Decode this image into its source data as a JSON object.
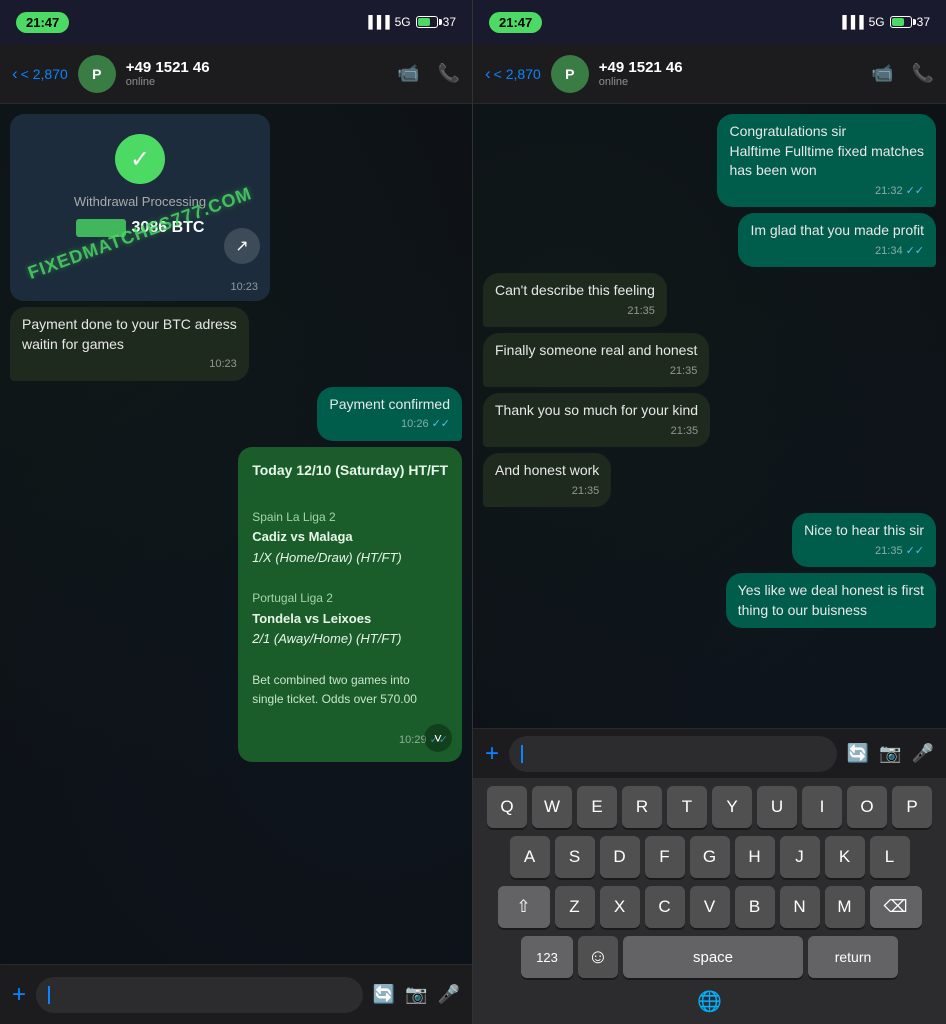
{
  "left_panel": {
    "status_bar": {
      "time": "21:47",
      "signal": "5G",
      "battery": "37"
    },
    "header": {
      "back_label": "< 2,870",
      "contact_name": "+49 1521 46",
      "contact_status": "online",
      "avatar_initials": "P"
    },
    "messages": [
      {
        "type": "incoming",
        "kind": "withdrawal_card",
        "check": "✓",
        "label": "Withdrawal Processing",
        "amount": "3086 BTC",
        "watermark": "FIXEDMATCHES777.COM",
        "time": "10:23"
      },
      {
        "type": "incoming",
        "text": "Payment done to your BTC adress\nwaitin for games",
        "time": "10:23"
      },
      {
        "type": "outgoing",
        "text": "Payment confirmed",
        "time": "10:26",
        "ticks": "✓✓"
      },
      {
        "type": "outgoing",
        "kind": "games_card",
        "title": "Today 12/10 (Saturday) HT/FT",
        "league1": "Spain La Liga 2",
        "match1": "Cadiz vs Malaga",
        "tip1": "1/X (Home/Draw) (HT/FT)",
        "league2": "Portugal Liga 2",
        "match2": "Tondela vs Leixoes",
        "tip2": "2/1 (Away/Home) (HT/FT)",
        "note": "Bet combined two games into\nsingle ticket. Odds over 570.00",
        "time": "10:29",
        "ticks": "✓✓"
      }
    ],
    "input_bar": {
      "plus": "+",
      "placeholder": ""
    }
  },
  "right_panel": {
    "status_bar": {
      "time": "21:47",
      "signal": "5G",
      "battery": "37"
    },
    "header": {
      "back_label": "< 2,870",
      "contact_name": "+49 1521 46",
      "contact_status": "online",
      "avatar_initials": "P"
    },
    "messages": [
      {
        "type": "outgoing",
        "text": "Congratulations sir\nHalftime Fulltime fixed matches\nhas been won",
        "time": "21:32",
        "ticks": "✓✓"
      },
      {
        "type": "outgoing",
        "text": "Im glad that you made profit",
        "time": "21:34",
        "ticks": "✓✓"
      },
      {
        "type": "incoming",
        "text": "Can't describe this feeling",
        "time": "21:35"
      },
      {
        "type": "incoming",
        "text": "Finally someone real and honest",
        "time": "21:35"
      },
      {
        "type": "incoming",
        "text": "Thank you so much for your kind",
        "time": "21:35"
      },
      {
        "type": "incoming",
        "text": "And honest work",
        "time": "21:35"
      },
      {
        "type": "outgoing",
        "text": "Nice to hear this sir",
        "time": "21:35",
        "ticks": "✓✓"
      },
      {
        "type": "outgoing",
        "text": "Yes like we deal honest is first\nthing to our buisness",
        "time": "",
        "ticks": ""
      }
    ],
    "keyboard": {
      "row1": [
        "Q",
        "W",
        "E",
        "R",
        "T",
        "Y",
        "U",
        "I",
        "O",
        "P"
      ],
      "row2": [
        "A",
        "S",
        "D",
        "F",
        "G",
        "H",
        "J",
        "K",
        "L"
      ],
      "row3": [
        "Z",
        "X",
        "C",
        "V",
        "B",
        "N",
        "M"
      ],
      "special_left": "⇧",
      "special_right": "⌫",
      "bottom_left": "123",
      "emoji": "☺",
      "space": "space",
      "return": "return",
      "globe": "🌐"
    }
  }
}
